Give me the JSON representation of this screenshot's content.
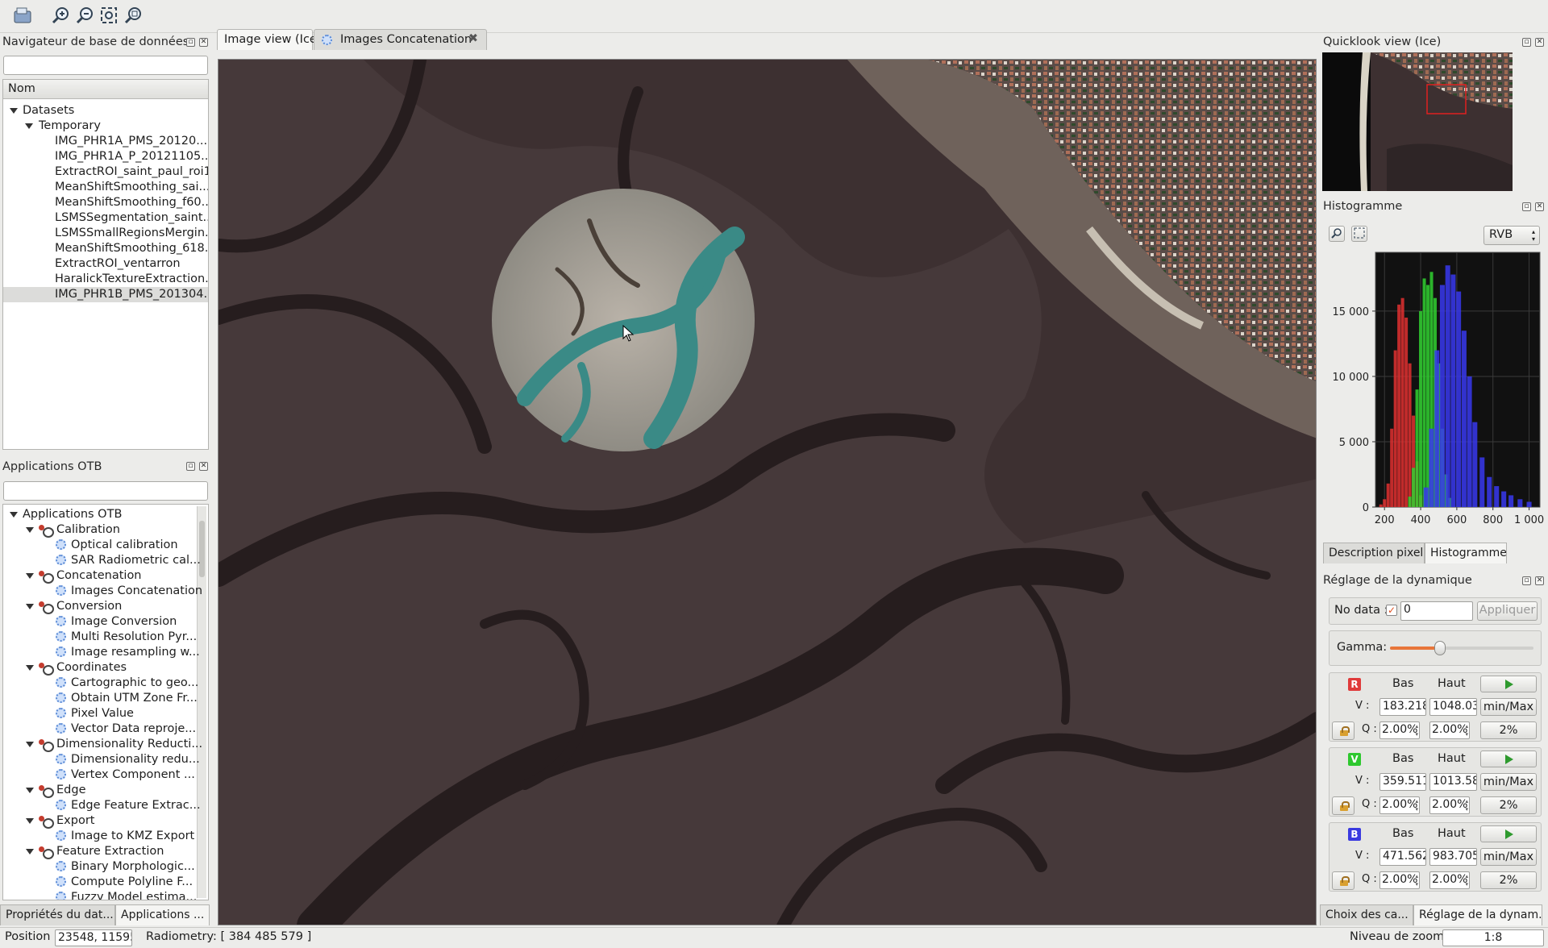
{
  "toolbar": {
    "icons": [
      "database-open-icon",
      "zoom-in-icon",
      "zoom-out-icon",
      "zoom-extent-icon",
      "zoom-full-icon"
    ]
  },
  "db_navigator": {
    "title": "Navigateur de base de données",
    "search_value": "",
    "column_header": "Nom",
    "root": "Datasets",
    "group": "Temporary",
    "items": [
      "IMG_PHR1A_PMS_20120...",
      "IMG_PHR1A_P_20121105...",
      "ExtractROI_saint_paul_roi1",
      "MeanShiftSmoothing_sai...",
      "MeanShiftSmoothing_f60...",
      "LSMSSegmentation_saint...",
      "LSMSSmallRegionsMergin...",
      "MeanShiftSmoothing_618...",
      "ExtractROI_ventarron",
      "HaralickTextureExtraction...",
      "IMG_PHR1B_PMS_201304..."
    ],
    "selected_index": 10
  },
  "otb_apps": {
    "title": "Applications OTB",
    "search_value": "",
    "root": "Applications OTB",
    "categories": [
      {
        "name": "Calibration",
        "apps": [
          "Optical calibration",
          "SAR Radiometric cal..."
        ]
      },
      {
        "name": "Concatenation",
        "apps": [
          "Images Concatenation"
        ]
      },
      {
        "name": "Conversion",
        "apps": [
          "Image Conversion",
          "Multi Resolution Pyr...",
          "Image resampling w..."
        ]
      },
      {
        "name": "Coordinates",
        "apps": [
          "Cartographic to geo...",
          "Obtain UTM Zone Fr...",
          "Pixel Value",
          "Vector Data reproje..."
        ]
      },
      {
        "name": "Dimensionality Reducti...",
        "apps": [
          "Dimensionality redu...",
          "Vertex Component ..."
        ]
      },
      {
        "name": "Edge",
        "apps": [
          "Edge Feature Extrac..."
        ]
      },
      {
        "name": "Export",
        "apps": [
          "Image to KMZ Export"
        ]
      },
      {
        "name": "Feature Extraction",
        "apps": [
          "Binary Morphologic...",
          "Compute Polyline F...",
          "Fuzzy Model estima..."
        ]
      }
    ]
  },
  "left_bottom_tabs": [
    "Propriétés du dat...",
    "Applications ..."
  ],
  "center_tabs": [
    {
      "label": "Image view (Ice)",
      "active": true
    },
    {
      "label": "Images Concatenation",
      "active": false
    }
  ],
  "quicklook": {
    "title": "Quicklook view (Ice)"
  },
  "histogram": {
    "title": "Histogramme",
    "mode": "RVB",
    "colors": {
      "r": "#e03030",
      "g": "#30d030",
      "b": "#3838ee"
    }
  },
  "chart_data": {
    "type": "bar",
    "xlabel": "",
    "ylabel": "",
    "xlim": [
      150,
      1060
    ],
    "ylim": [
      0,
      19500
    ],
    "x_ticks": [
      200,
      400,
      600,
      800,
      1000
    ],
    "x_tick_labels": [
      "200",
      "400",
      "600",
      "800",
      "1 000"
    ],
    "y_ticks": [
      0,
      5000,
      10000,
      15000
    ],
    "y_tick_labels": [
      "0",
      "5 000",
      "10 000",
      "15 000"
    ],
    "grid": true,
    "series": [
      {
        "color": "#e03030",
        "x": [
          180,
          200,
          220,
          240,
          260,
          280,
          300,
          320,
          340,
          360,
          380,
          400
        ],
        "values": [
          200,
          600,
          1800,
          6000,
          12000,
          15500,
          16000,
          14500,
          11000,
          7000,
          3500,
          900
        ]
      },
      {
        "color": "#30d030",
        "x": [
          340,
          360,
          380,
          400,
          420,
          440,
          460,
          480,
          500,
          520,
          540,
          560
        ],
        "values": [
          800,
          3000,
          9000,
          15000,
          17500,
          17000,
          18000,
          16000,
          11000,
          6000,
          2500,
          700
        ]
      },
      {
        "color": "#3838ee",
        "x": [
          430,
          460,
          490,
          520,
          550,
          580,
          610,
          640,
          670,
          700,
          740,
          780,
          820,
          860,
          900,
          950,
          1000
        ],
        "values": [
          1500,
          6000,
          12000,
          17000,
          18500,
          17800,
          16500,
          13500,
          10000,
          6500,
          3800,
          2300,
          1600,
          1200,
          900,
          600,
          400
        ]
      }
    ]
  },
  "right_mid_tabs": [
    "Description pixel",
    "Histogramme"
  ],
  "dynamics": {
    "title": "Réglage de la dynamique",
    "nodata_label": "No data :",
    "nodata_value": "0",
    "apply_label": "Appliquer",
    "gamma_label": "Gamma:",
    "gamma_level": 0.35,
    "low_label": "Bas",
    "high_label": "Haut",
    "v_label": "V :",
    "q_label": "Q :",
    "minmax_label": "min/Max",
    "pct_label": "2%",
    "channels": [
      {
        "letter": "R",
        "color": "#e03a3a",
        "v_low": "183.218",
        "v_high": "1048.03",
        "q_low": "2.00%",
        "q_high": "2.00%"
      },
      {
        "letter": "V",
        "color": "#2ec82e",
        "v_low": "359.511",
        "v_high": "1013.58",
        "q_low": "2.00%",
        "q_high": "2.00%"
      },
      {
        "letter": "B",
        "color": "#3a3ae0",
        "v_low": "471.562",
        "v_high": "983.705",
        "q_low": "2.00%",
        "q_high": "2.00%"
      }
    ]
  },
  "right_bottom_tabs": [
    "Choix des ca...",
    "Réglage de la dynam..."
  ],
  "status": {
    "position_label": "Position",
    "position_value": "23548, 11595",
    "radiometry": "Radiometry: [ 384 485 579 ]",
    "zoom_label": "Niveau de zoom",
    "zoom_value": "1:8"
  }
}
